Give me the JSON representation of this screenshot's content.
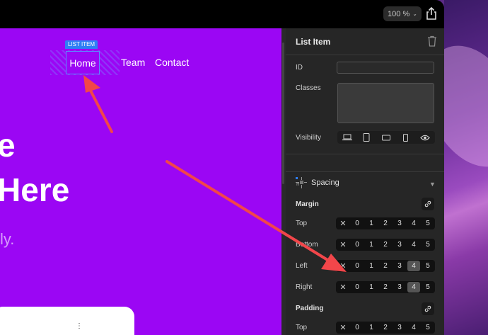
{
  "toolbar": {
    "zoom": "100 %"
  },
  "canvas": {
    "selection_tag": "LIST ITEM",
    "nav": [
      "Home",
      "Team",
      "Contact"
    ],
    "hero_line1": "e",
    "hero_line2": "Here",
    "hero_sub": "ly.",
    "card_dots": "⋮"
  },
  "panel": {
    "title": "List Item",
    "id_label": "ID",
    "classes_label": "Classes",
    "visibility_label": "Visibility",
    "spacing_title": "Spacing",
    "margin_label": "Margin",
    "padding_label": "Padding",
    "margin_rows": [
      {
        "label": "Top",
        "active": null
      },
      {
        "label": "Bottom",
        "active": null
      },
      {
        "label": "Left",
        "active": 4
      },
      {
        "label": "Right",
        "active": 4
      }
    ],
    "padding_rows": [
      {
        "label": "Top",
        "active": null
      }
    ],
    "scale": [
      "0",
      "1",
      "2",
      "3",
      "4",
      "5"
    ]
  },
  "colors": {
    "canvas_bg": "#9b06f4",
    "selection": "#2f7ef5",
    "arrow": "#f2464a"
  }
}
